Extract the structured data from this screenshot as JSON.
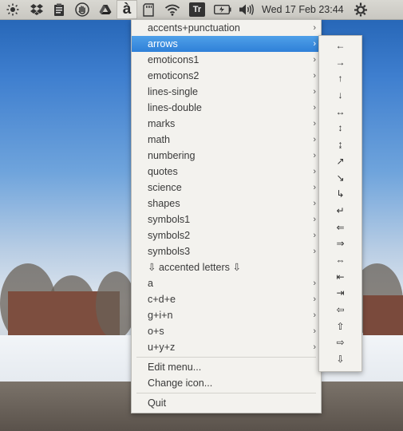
{
  "panel": {
    "icons": [
      "brightness-icon",
      "dropbox-icon",
      "clipboard-icon",
      "hand-stop-icon",
      "google-drive-icon",
      "accent-a-icon",
      "sdcard-icon",
      "wifi-icon",
      "translator-icon",
      "battery-icon",
      "volume-icon",
      "power-icon"
    ],
    "accent_label": "à",
    "translator_label": "Tr",
    "clock": "Wed 17 Feb 23:44"
  },
  "menu": {
    "items": [
      {
        "label": "accents+punctuation",
        "submenu": true
      },
      {
        "label": "arrows",
        "submenu": true,
        "highlighted": true
      },
      {
        "label": "emoticons1",
        "submenu": true
      },
      {
        "label": "emoticons2",
        "submenu": true
      },
      {
        "label": "lines-single",
        "submenu": true
      },
      {
        "label": "lines-double",
        "submenu": true
      },
      {
        "label": "marks",
        "submenu": true
      },
      {
        "label": "math",
        "submenu": true
      },
      {
        "label": "numbering",
        "submenu": true
      },
      {
        "label": "quotes",
        "submenu": true
      },
      {
        "label": "science",
        "submenu": true
      },
      {
        "label": "shapes",
        "submenu": true
      },
      {
        "label": "symbols1",
        "submenu": true
      },
      {
        "label": "symbols2",
        "submenu": true
      },
      {
        "label": "symbols3",
        "submenu": true
      },
      {
        "label": "⇩ accented letters ⇩",
        "submenu": false
      },
      {
        "label": "a",
        "submenu": true
      },
      {
        "label": "c+d+e",
        "submenu": true
      },
      {
        "label": "g+i+n",
        "submenu": true
      },
      {
        "label": "o+s",
        "submenu": true
      },
      {
        "label": "u+y+z",
        "submenu": true
      }
    ],
    "actions": [
      "Edit menu...",
      "Change icon...",
      "Quit"
    ],
    "chevron": "›"
  },
  "arrows_submenu": {
    "items": [
      "←",
      "→",
      "↑",
      "↓",
      "↔",
      "↕",
      "↨",
      "↗",
      "↘",
      "↳",
      "↵",
      "⇐",
      "⇒",
      "⇔",
      "⇤",
      "⇥",
      "⇦",
      "⇧",
      "⇨",
      "⇩"
    ]
  },
  "colors": {
    "highlight": "#3d8fe0",
    "menu_bg": "#f3f2ee",
    "panel_bg": "#d3d2cc"
  }
}
